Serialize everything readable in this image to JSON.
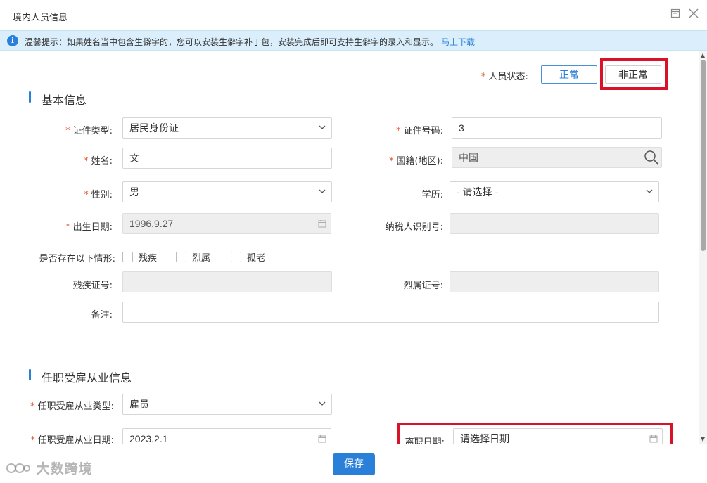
{
  "window": {
    "title": "境内人员信息"
  },
  "notice": {
    "text": "温馨提示：如果姓名当中包含生僻字的，您可以安装生僻字补丁包，安装完成后即可支持生僻字的录入和显示。",
    "link": "马上下载"
  },
  "status": {
    "label": "人员状态:",
    "normal": "正常",
    "abnormal": "非正常"
  },
  "basic": {
    "title": "基本信息",
    "id_type": {
      "label": "证件类型:",
      "value": "居民身份证"
    },
    "id_number": {
      "label": "证件号码:",
      "value": "3"
    },
    "name": {
      "label": "姓名:",
      "value": "文"
    },
    "nationality": {
      "label": "国籍(地区):",
      "value": "中国"
    },
    "gender": {
      "label": "性别:",
      "value": "男"
    },
    "education": {
      "label": "学历:",
      "value": "- 请选择 -"
    },
    "birth_date": {
      "label": "出生日期:",
      "value": "1996.9.27"
    },
    "taxpayer_id": {
      "label": "纳税人识别号:",
      "value": ""
    },
    "situation": {
      "label": "是否存在以下情形:",
      "options": [
        "残疾",
        "烈属",
        "孤老"
      ]
    },
    "disability_no": {
      "label": "残疾证号:",
      "value": ""
    },
    "martyr_no": {
      "label": "烈属证号:",
      "value": ""
    },
    "remark": {
      "label": "备注:",
      "value": ""
    }
  },
  "employment": {
    "title": "任职受雇从业信息",
    "type": {
      "label": "任职受雇从业类型:",
      "value": "雇员"
    },
    "date": {
      "label": "任职受雇从业日期:",
      "value": "2023.2.1"
    },
    "leave_date": {
      "label": "离职日期:",
      "placeholder": "请选择日期"
    }
  },
  "footer": {
    "save": "保存",
    "watermark": "大数跨境"
  },
  "colors": {
    "accent": "#2a7fd8",
    "highlight_box": "#d9122a",
    "required": "#e4572e"
  }
}
